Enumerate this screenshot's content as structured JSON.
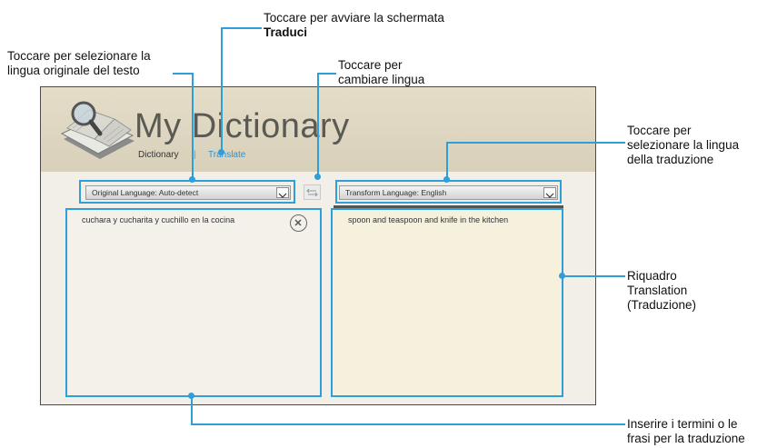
{
  "app": {
    "title": "My Dictionary",
    "nav": {
      "dictionary_label": "Dictionary",
      "separator": "|",
      "translate_label": "Translate"
    }
  },
  "source_language": {
    "selected": "Original Language: Auto-detect"
  },
  "target_language": {
    "selected": "Transform Language: English"
  },
  "input_pane": {
    "text": "cuchara y cucharita y cuchillo en la cocina"
  },
  "output_pane": {
    "text": "spoon and teaspoon and knife in the kitchen"
  },
  "annotations": {
    "translate_tab_line1": "Toccare per avviare la schermata",
    "translate_tab_line2": "Traduci",
    "source_lang_line1": "Toccare per selezionare la",
    "source_lang_line2": "lingua originale del testo",
    "swap_line1": "Toccare per",
    "swap_line2": "cambiare lingua",
    "target_lang_line1": "Toccare per",
    "target_lang_line2": "selezionare la lingua",
    "target_lang_line3": "della traduzione",
    "output_pane_line1": "Riquadro",
    "output_pane_line2": "Translation",
    "output_pane_line3": "(Traduzione)",
    "input_pane_line1": "Inserire i termini o le",
    "input_pane_line2": "frasi per la traduzione"
  },
  "colors": {
    "callout": "#2e9fd8",
    "header": "#d8d0b9",
    "output_pane": "#f6f1dc",
    "translate_tab": "#2f8fd0"
  }
}
